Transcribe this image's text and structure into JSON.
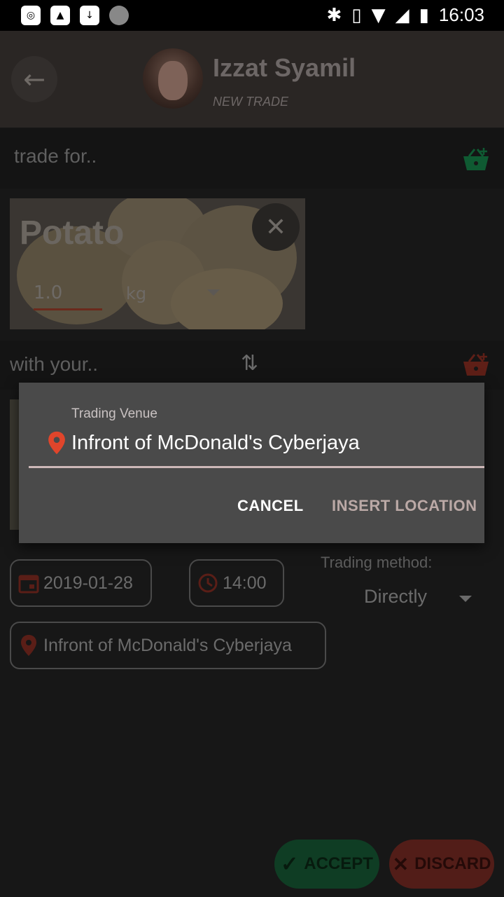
{
  "status_bar": {
    "time": "16:03",
    "left_icons": [
      "notification-icon",
      "image-icon",
      "download-icon",
      "sync-icon"
    ],
    "right_icons": [
      "bluetooth-icon",
      "vibrate-icon",
      "wifi-icon",
      "signal-icon",
      "battery-icon"
    ]
  },
  "header": {
    "user_name": "Izzat Syamil",
    "subtitle": "NEW TRADE"
  },
  "trade_for": {
    "label": "trade for..",
    "item": {
      "name": "Potato",
      "quantity": "1.0",
      "unit": "kg"
    }
  },
  "with_your": {
    "label": "with your.."
  },
  "trade_meta": {
    "date": "2019-01-28",
    "time": "14:00",
    "method_label": "Trading method:",
    "method_value": "Directly",
    "location": "Infront of McDonald's Cyberjaya"
  },
  "dialog": {
    "label": "Trading Venue",
    "value": "Infront of McDonald's Cyberjaya",
    "cancel_label": "CANCEL",
    "insert_label": "INSERT LOCATION"
  },
  "actions": {
    "accept_label": "ACCEPT",
    "discard_label": "DISCARD"
  },
  "colors": {
    "accent_red": "#e0452b",
    "accent_green": "#1e8f4a",
    "dialog_bg": "#4a4a4a"
  }
}
